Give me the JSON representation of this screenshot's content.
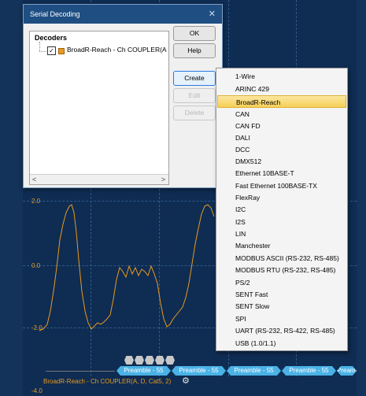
{
  "dialog": {
    "title": "Serial Decoding",
    "tree_root": "Decoders",
    "decoder_item": "BroadR-Reach - Ch COUPLER(A",
    "buttons": {
      "ok": "OK",
      "help": "Help",
      "create": "Create",
      "edit": "Edit",
      "delete": "Delete"
    }
  },
  "menu": {
    "items": [
      "1-Wire",
      "ARINC 429",
      "BroadR-Reach",
      "CAN",
      "CAN FD",
      "DALI",
      "DCC",
      "DMX512",
      "Ethernet 10BASE-T",
      "Fast Ethernet 100BASE-TX",
      "FlexRay",
      "I2C",
      "I2S",
      "LIN",
      "Manchester",
      "MODBUS ASCII (RS-232, RS-485)",
      "MODBUS RTU (RS-232, RS-485)",
      "PS/2",
      "SENT Fast",
      "SENT Slow",
      "SPI",
      "UART (RS-232, RS-422, RS-485)",
      "USB (1.0/1.1)"
    ],
    "selected": "BroadR-Reach"
  },
  "scope": {
    "y_labels": [
      "2.0",
      "0.0",
      "-2.0",
      "-4.0"
    ],
    "channel_label": "BroadR-Reach - Ch COUPLER(A, D, Cat5, 2)",
    "packets": [
      "Preamble - 55",
      "Preamble - 55",
      "Preamble - 55",
      "Preamble - 55",
      "Preamble - 55",
      "Preamble -"
    ],
    "trace_color": "#e89a20",
    "packet_color": "#4ab2e6"
  }
}
